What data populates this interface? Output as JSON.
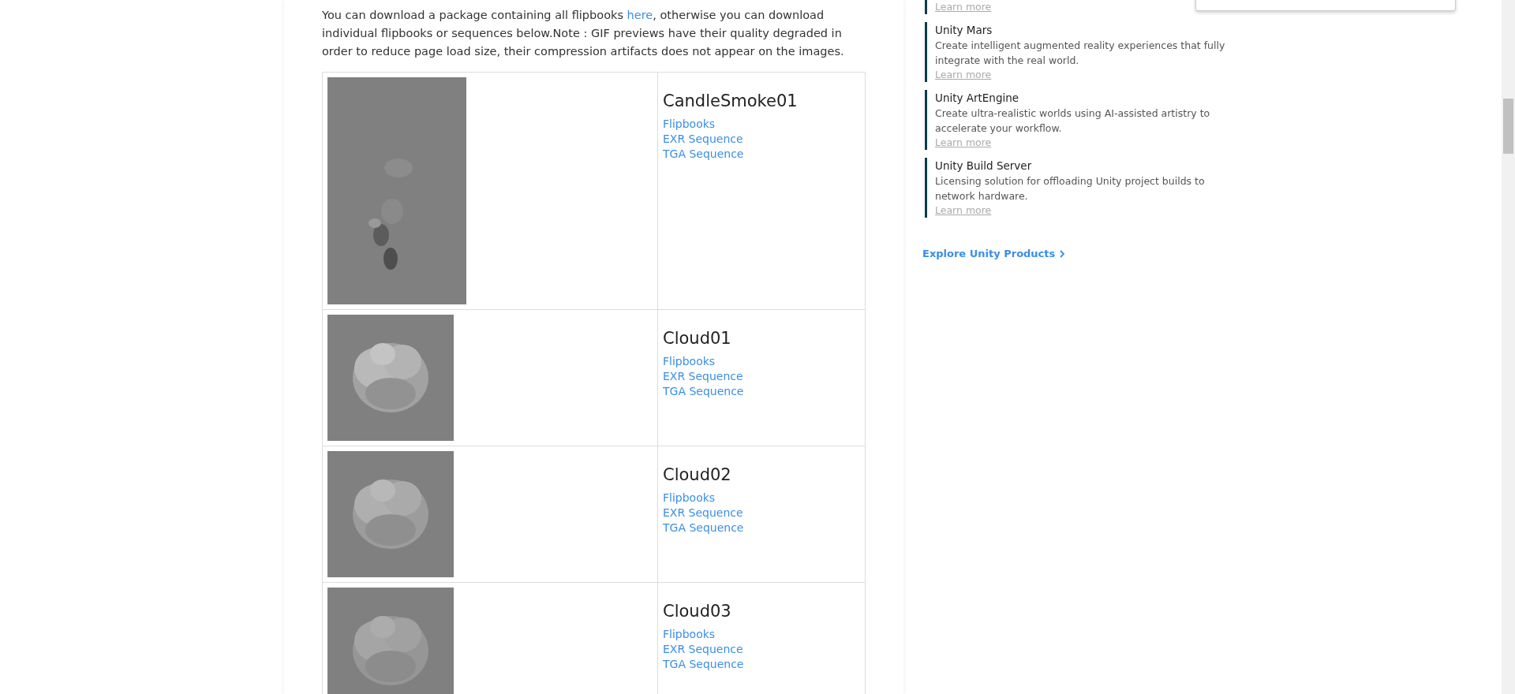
{
  "intro": {
    "before": "You can download a package containing all flipbooks ",
    "link": "here",
    "after": ", otherwise you can download individual flipbooks or sequences below.Note : GIF previews have their quality degraded in order to reduce page load size, their compression artifacts does not appear on the images."
  },
  "flipbooks": [
    {
      "name": "CandleSmoke01",
      "preview": {
        "kind": "picture"
      },
      "links": [
        "Flipbooks",
        "EXR Sequence",
        "TGA Sequence"
      ]
    },
    {
      "name": "Cloud01",
      "preview": {
        "kind": "picture"
      },
      "links": [
        "Flipbooks",
        "EXR Sequence",
        "TGA Sequence"
      ]
    },
    {
      "name": "Cloud02",
      "preview": {
        "kind": "picture"
      },
      "links": [
        "Flipbooks",
        "EXR Sequence",
        "TGA Sequence"
      ]
    },
    {
      "name": "Cloud03",
      "preview": {
        "kind": "picture"
      },
      "links": [
        "Flipbooks",
        "EXR Sequence",
        "TGA Sequence"
      ]
    }
  ],
  "sidebar": {
    "products": [
      {
        "learn_more": "Learn more"
      },
      {
        "title": "Unity Mars",
        "description": "Create intelligent augmented reality experiences that fully integrate with the real world.",
        "learn_more": "Learn more"
      },
      {
        "title": "Unity ArtEngine",
        "description": "Create ultra-realistic worlds using AI-assisted artistry to accelerate your workflow.",
        "learn_more": "Learn more"
      },
      {
        "title": "Unity Build Server",
        "description": "Licensing solution for offloading Unity project builds to network hardware.",
        "learn_more": "Learn more"
      }
    ],
    "explore": "Explore Unity Products"
  }
}
